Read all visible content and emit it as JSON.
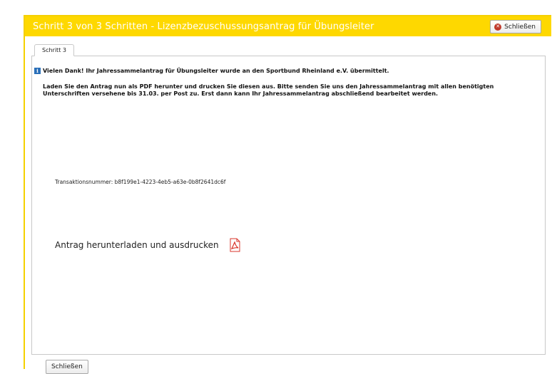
{
  "dialog": {
    "title": "Schritt 3 von 3 Schritten - Lizenzbezuschussungsantrag für Übungsleiter",
    "close_top_label": "Schließen",
    "tab_label": "Schritt 3",
    "info_message": "Vielen Dank! Ihr Jahressammelantrag für Übungsleiter wurde an den Sportbund Rheinland e.V. übermittelt.",
    "instructions": "Laden Sie den Antrag nun als PDF herunter und drucken Sie diesen aus. Bitte senden Sie uns den Jahressammelantrag mit allen benötigten Unterschriften versehene bis 31.03. per Post zu. Erst dann kann Ihr Jahressammelantrag abschließend bearbeitet werden.",
    "transaction_text": "Transaktionsnummer: b8f199e1-4223-4eb5-a63e-0b8f2641dc6f",
    "download_label": "Antrag herunterladen und ausdrucken",
    "close_bottom_label": "Schließen"
  },
  "icons": {
    "info": "info-icon",
    "close": "close-icon",
    "pdf": "pdf-icon"
  },
  "colors": {
    "title_bar": "#fed800",
    "title_text": "#ffffff",
    "close_icon": "#c0392b",
    "info_icon": "#2a6fb8",
    "pdf_icon": "#d9342b"
  }
}
